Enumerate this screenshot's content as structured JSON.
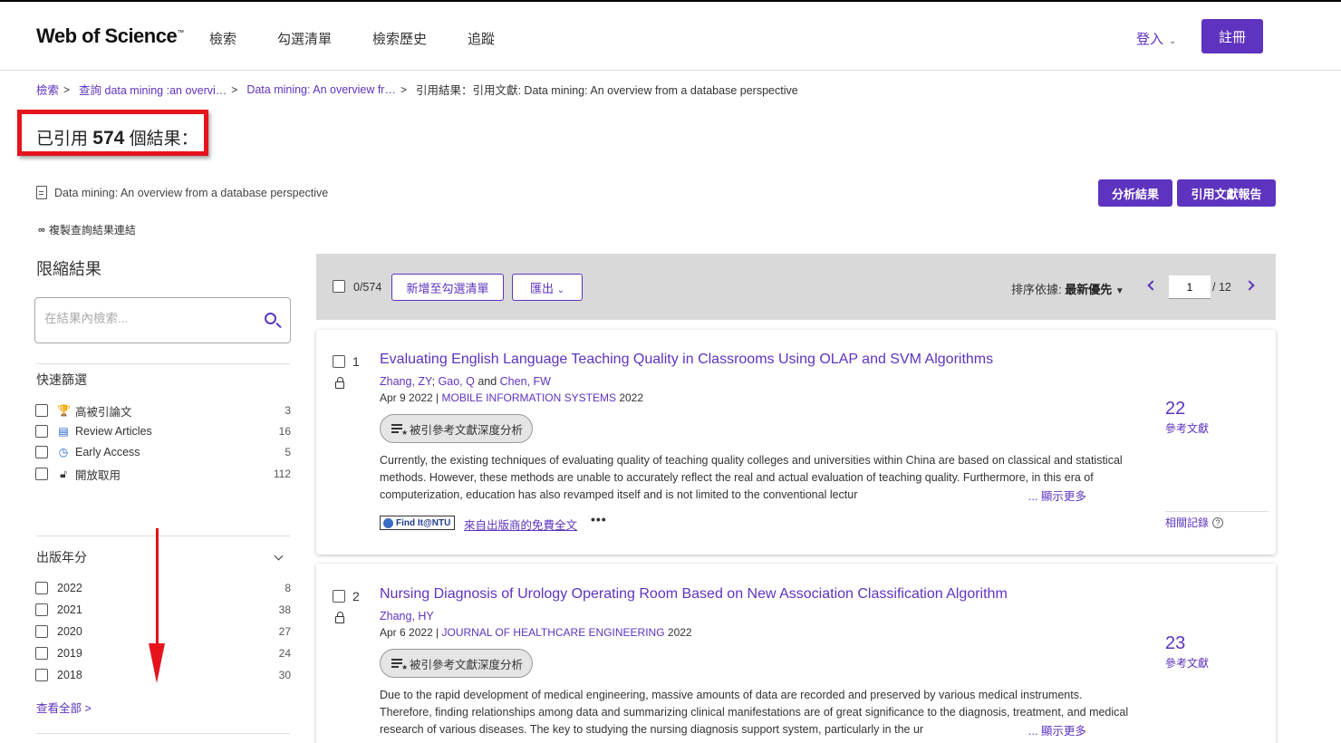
{
  "header": {
    "logo": "Web of Science",
    "logo_tm": "™",
    "nav": [
      "檢索",
      "勾選清單",
      "檢索歷史",
      "追蹤"
    ],
    "login": "登入",
    "register": "註冊"
  },
  "breadcrumb": {
    "items": [
      "檢索",
      "查詢 data mining :an overvi…",
      "Data mining: An overview fr…"
    ],
    "current": "引用結果：引用文獻: Data mining: An overview from a database perspective"
  },
  "results": {
    "prefix": "已引用",
    "count": "574",
    "suffix": "個結果："
  },
  "source_title": "Data mining: An overview from a database perspective",
  "copy_link": "複製查詢結果連結",
  "buttons": {
    "analyze": "分析結果",
    "citation_report": "引用文獻報告"
  },
  "sidebar": {
    "title": "限縮結果",
    "search_placeholder": "在結果內檢索...",
    "quick_filters_title": "快速篩選",
    "quick_filters": [
      {
        "label": "高被引論文",
        "count": "3"
      },
      {
        "label": "Review Articles",
        "count": "16"
      },
      {
        "label": "Early Access",
        "count": "5"
      },
      {
        "label": "開放取用",
        "count": "112"
      }
    ],
    "years_title": "出版年分",
    "years": [
      {
        "label": "2022",
        "count": "8"
      },
      {
        "label": "2021",
        "count": "38"
      },
      {
        "label": "2020",
        "count": "27"
      },
      {
        "label": "2019",
        "count": "24"
      },
      {
        "label": "2018",
        "count": "30"
      }
    ],
    "see_all": "查看全部 >"
  },
  "toolbar": {
    "selected": "0/574",
    "add_to_list": "新增至勾選清單",
    "export": "匯出",
    "sort_label": "排序依據:",
    "sort_value": "最新優先",
    "page": "1",
    "total_pages": "/ 12"
  },
  "records": [
    {
      "num": "1",
      "title": "Evaluating English Language Teaching Quality in Classrooms Using OLAP and SVM Algorithms",
      "authors": [
        "Zhang, ZY",
        "Gao, Q",
        "Chen, FW"
      ],
      "author_sep": ";",
      "author_and": "and",
      "date": "Apr 9 2022",
      "journal": "MOBILE INFORMATION SYSTEMS",
      "year": "2022",
      "analysis_btn": "被引參考文獻深度分析",
      "abstract": "Currently, the existing techniques of evaluating quality of teaching quality colleges and universities within China are based on classical and statistical methods. However, these methods are unable to accurately reflect the real and actual evaluation of teaching quality. Furthermore, in this era of computerization, education has also revamped itself and is not limited to the conventional lectur",
      "show_more": "... 顯示更多",
      "cite_count": "22",
      "cite_label": "參考文獻",
      "related": "相關記錄",
      "findit": "Find It@NTU",
      "free_text": "來自出版商的免費全文",
      "more": "•••"
    },
    {
      "num": "2",
      "title": "Nursing Diagnosis of Urology Operating Room Based on New Association Classification Algorithm",
      "authors": [
        "Zhang, HY"
      ],
      "date": "Apr 6 2022",
      "journal": "JOURNAL OF HEALTHCARE ENGINEERING",
      "year": "2022",
      "analysis_btn": "被引參考文獻深度分析",
      "abstract": "Due to the rapid development of medical engineering, massive amounts of data are recorded and preserved by various medical instruments. Therefore, finding relationships among data and summarizing clinical manifestations are of great significance to the diagnosis, treatment, and medical research of various diseases. The key to studying the nursing diagnosis support system, particularly in the ur",
      "show_more": "... 顯示更多",
      "cite_count": "23",
      "cite_label": "參考文獻"
    }
  ]
}
